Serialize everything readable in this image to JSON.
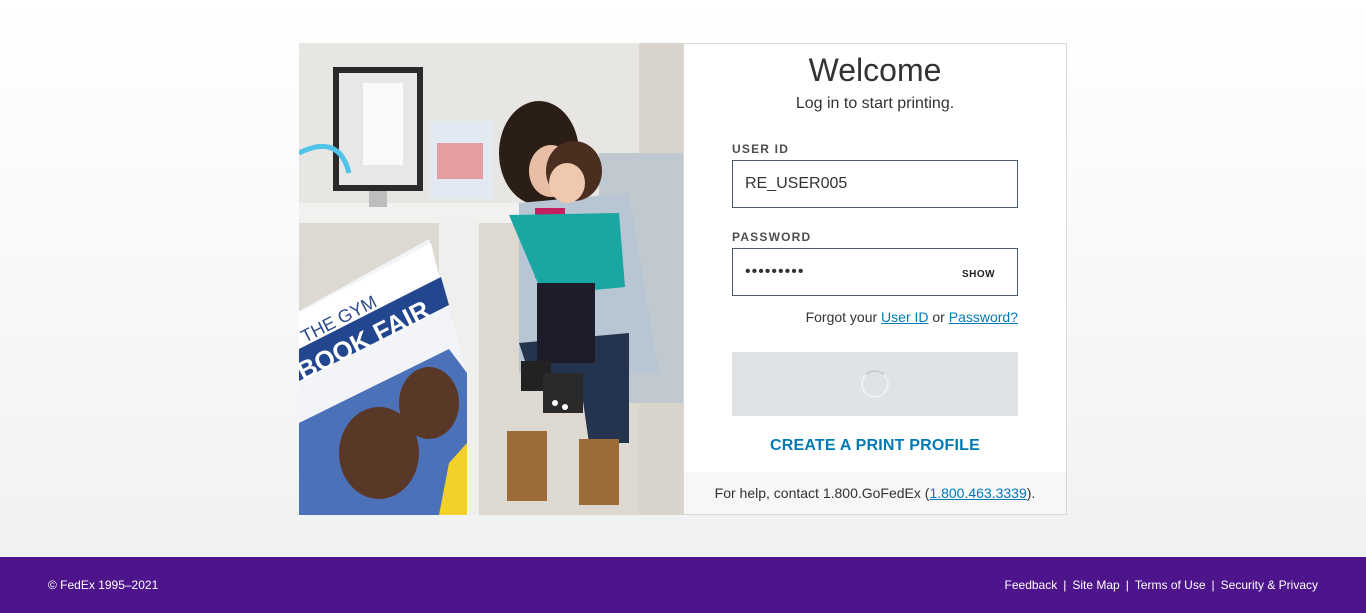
{
  "login": {
    "title": "Welcome",
    "subtitle": "Log in to start printing.",
    "user_id_label": "USER ID",
    "user_id_value": "RE_USER005",
    "password_label": "PASSWORD",
    "password_value": "•••••••••",
    "show_label": "SHOW",
    "forgot_prefix": "Forgot your",
    "forgot_user_id": "User ID",
    "forgot_or": "or",
    "forgot_password": "Password?",
    "create_profile": "CREATE A PRINT PROFILE",
    "help_prefix": "For help, contact 1.800.GoFedEx (",
    "help_phone": "1.800.463.3339",
    "help_suffix": ")."
  },
  "photo": {
    "sign_text_1": "THE GYM",
    "sign_text_2": "BOOK FAIR",
    "sign_text_3": "FAIR"
  },
  "footer": {
    "copyright": "© FedEx 1995–2021",
    "links": [
      "Feedback",
      "Site Map",
      "Terms of Use",
      "Security & Privacy"
    ]
  },
  "colors": {
    "brand_purple": "#4d148c",
    "link_blue": "#007ab7",
    "button_disabled": "#dfe3e6"
  },
  "icons": {
    "spinner": "loading-spinner-icon"
  }
}
